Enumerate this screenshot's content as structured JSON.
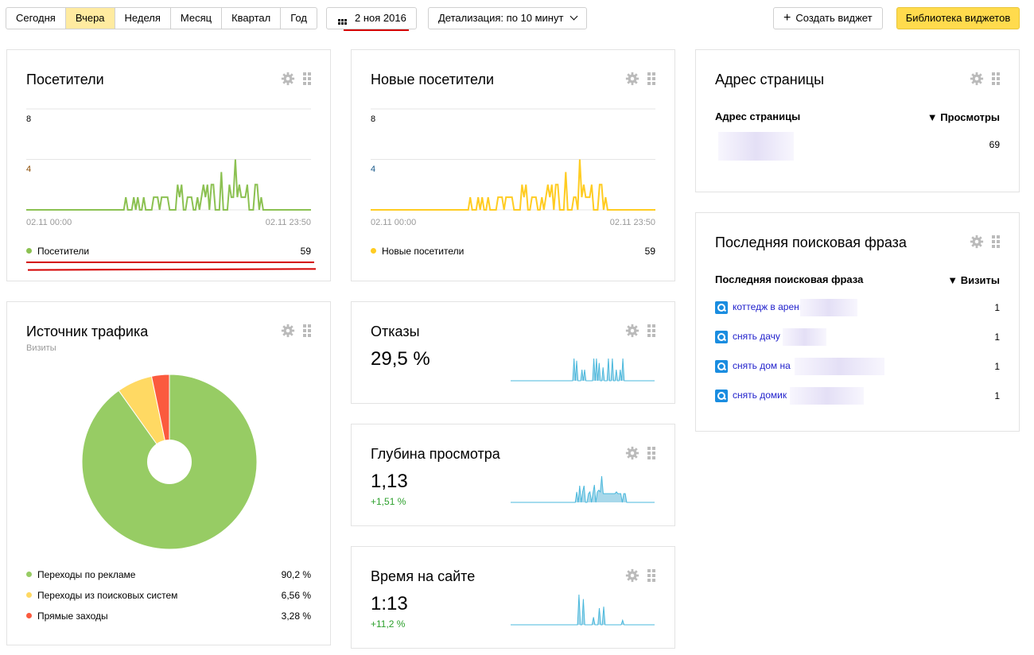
{
  "toolbar": {
    "periods": [
      "Сегодня",
      "Вчера",
      "Неделя",
      "Месяц",
      "Квартал",
      "Год"
    ],
    "active_period": "Вчера",
    "date": "2 ноя 2016",
    "detail": "Детализация: по 10 минут",
    "create_widget": "Создать виджет",
    "library": "Библиотека виджетов",
    "accent": "#ffdb4d"
  },
  "visitors": {
    "title": "Посетители",
    "y_ticks": [
      "8",
      "4"
    ],
    "x_start": "02.11 00:00",
    "x_end": "02.11 23:50",
    "legend": "Посетители",
    "total": "59",
    "color": "#8cc152"
  },
  "new_visitors": {
    "title": "Новые посетители",
    "y_ticks": [
      "8",
      "4"
    ],
    "x_start": "02.11 00:00",
    "x_end": "02.11 23:50",
    "legend": "Новые посетители",
    "total": "59",
    "color": "#ffcc22"
  },
  "chart_data": [
    {
      "type": "line",
      "series": [
        {
          "name": "Посетители",
          "values": {
            "50": 1,
            "54": 1,
            "56": 1,
            "59": 1,
            "64": 1,
            "65": 1,
            "66": 1,
            "68": 1,
            "69": 1,
            "70": 1,
            "71": 1,
            "76": 2,
            "77": 1,
            "78": 2,
            "81": 1,
            "82": 1,
            "83": 1,
            "86": 1,
            "88": 1,
            "89": 2,
            "90": 1,
            "91": 2,
            "93": 2,
            "94": 2,
            "98": 3,
            "102": 2,
            "103": 1,
            "104": 1,
            "105": 4,
            "106": 1,
            "107": 2,
            "108": 1,
            "109": 1,
            "110": 1,
            "111": 2,
            "115": 2,
            "116": 2,
            "118": 1
          }
        }
      ],
      "points": 144,
      "ylim": [
        0,
        8
      ],
      "y_ticks": [
        4,
        8
      ],
      "x_range": [
        "02.11 00:00",
        "02.11 23:50"
      ]
    },
    {
      "type": "line",
      "series": [
        {
          "name": "Новые посетители",
          "values": {
            "50": 1,
            "54": 1,
            "56": 1,
            "59": 1,
            "64": 1,
            "65": 1,
            "66": 1,
            "68": 1,
            "69": 1,
            "70": 1,
            "71": 1,
            "76": 2,
            "77": 1,
            "78": 2,
            "81": 1,
            "82": 1,
            "83": 1,
            "86": 1,
            "88": 1,
            "89": 2,
            "90": 1,
            "91": 2,
            "93": 2,
            "94": 2,
            "98": 3,
            "102": 1,
            "103": 1,
            "105": 4,
            "106": 1,
            "107": 2,
            "108": 1,
            "109": 1,
            "110": 1,
            "111": 2,
            "115": 2,
            "116": 2,
            "118": 1
          }
        }
      ],
      "points": 144,
      "ylim": [
        0,
        8
      ],
      "y_ticks": [
        4,
        8
      ],
      "x_range": [
        "02.11 00:00",
        "02.11 23:50"
      ]
    },
    {
      "type": "pie",
      "title": "Источник трафика",
      "subtitle": "Визиты",
      "categories": [
        "Переходы по рекламе",
        "Переходы из поисковых систем",
        "Прямые заходы"
      ],
      "values": [
        90.2,
        6.56,
        3.28
      ],
      "labels": [
        "90,2 %",
        "6,56 %",
        "3,28 %"
      ],
      "colors": [
        "#97cc64",
        "#ffd963",
        "#fb5a3e"
      ]
    }
  ],
  "traffic": {
    "title": "Источник трафика",
    "subtitle": "Визиты"
  },
  "bounce": {
    "title": "Отказы",
    "value": "29,5 %",
    "spark": [
      0,
      0,
      0,
      0,
      0,
      0,
      0,
      0,
      0,
      0,
      0,
      0,
      0,
      0,
      0,
      0,
      0,
      0,
      0,
      0,
      0,
      0,
      0,
      0,
      0,
      0,
      0,
      0,
      0,
      0,
      0,
      0,
      0,
      0,
      0,
      0,
      0,
      0,
      0,
      0,
      0,
      0,
      0,
      0,
      0,
      0,
      0,
      0,
      1,
      0,
      0.9,
      0,
      0,
      0,
      0.5,
      0,
      0.5,
      0,
      0,
      0,
      0,
      0,
      0,
      1,
      0,
      1,
      0,
      0.8,
      0,
      0,
      0.6,
      0,
      0,
      0,
      1,
      0,
      0,
      1,
      0,
      0,
      0.5,
      0,
      0,
      0.5,
      0,
      1,
      0,
      0,
      0,
      0,
      0,
      0,
      0,
      0,
      0,
      0,
      0,
      0,
      0,
      0,
      0,
      0,
      0,
      0,
      0,
      0,
      0,
      0,
      0,
      0
    ]
  },
  "depth": {
    "title": "Глубина просмотра",
    "value": "1,13",
    "delta": "+1,51 %",
    "spark": [
      0,
      0,
      0,
      0,
      0,
      0,
      0,
      0,
      0,
      0,
      0,
      0,
      0,
      0,
      0,
      0,
      0,
      0,
      0,
      0,
      0,
      0,
      0,
      0,
      0,
      0,
      0,
      0,
      0,
      0,
      0,
      0,
      0,
      0,
      0,
      0,
      0,
      0,
      0,
      0,
      0,
      0,
      0,
      0,
      0,
      0.6,
      0,
      0.95,
      0,
      0.6,
      0.95,
      0,
      0,
      0.5,
      0.6,
      0,
      0.5,
      1,
      0,
      0.6,
      0.7,
      0.6,
      1.5,
      0.5,
      0.5,
      0.5,
      0.5,
      0.5,
      0.5,
      0.5,
      0.5,
      0.5,
      0.6,
      0.5,
      0.5,
      0.5,
      0,
      0.5,
      0.5,
      0,
      0,
      0,
      0,
      0,
      0,
      0,
      0,
      0,
      0,
      0,
      0,
      0,
      0,
      0,
      0,
      0,
      0,
      0,
      0
    ]
  },
  "time": {
    "title": "Время на сайте",
    "value": "1:13",
    "delta": "+11,2 %",
    "spark": [
      0,
      0,
      0,
      0,
      0,
      0,
      0,
      0,
      0,
      0,
      0,
      0,
      0,
      0,
      0,
      0,
      0,
      0,
      0,
      0,
      0,
      0,
      0,
      0,
      0,
      0,
      0,
      0,
      0,
      0,
      0,
      0,
      0,
      0,
      0,
      0,
      0,
      0,
      0,
      0,
      0,
      0,
      0,
      0,
      0,
      0,
      0,
      1.0,
      0,
      0,
      0.85,
      0,
      0,
      0,
      0,
      0,
      0,
      0.25,
      0,
      0,
      0,
      0.55,
      0,
      0,
      0.6,
      0,
      0,
      0,
      0,
      0,
      0,
      0,
      0,
      0,
      0,
      0,
      0,
      0.15,
      0,
      0,
      0,
      0,
      0,
      0,
      0,
      0,
      0,
      0,
      0,
      0,
      0,
      0,
      0,
      0,
      0,
      0,
      0,
      0,
      0,
      0
    ]
  },
  "page_address": {
    "title": "Адрес страницы",
    "col1": "Адрес страницы",
    "col2": "▼ Просмотры",
    "rows": [
      {
        "value": "69"
      }
    ]
  },
  "search_phrase": {
    "title": "Последняя поисковая фраза",
    "col1": "Последняя поисковая фраза",
    "col2": "▼ Визиты",
    "rows": [
      {
        "phrase": "коттедж в арен",
        "visits": "1"
      },
      {
        "phrase": "снять дачу",
        "visits": "1"
      },
      {
        "phrase": "снять дом на",
        "visits": "1"
      },
      {
        "phrase": "снять домик",
        "visits": "1"
      }
    ]
  }
}
